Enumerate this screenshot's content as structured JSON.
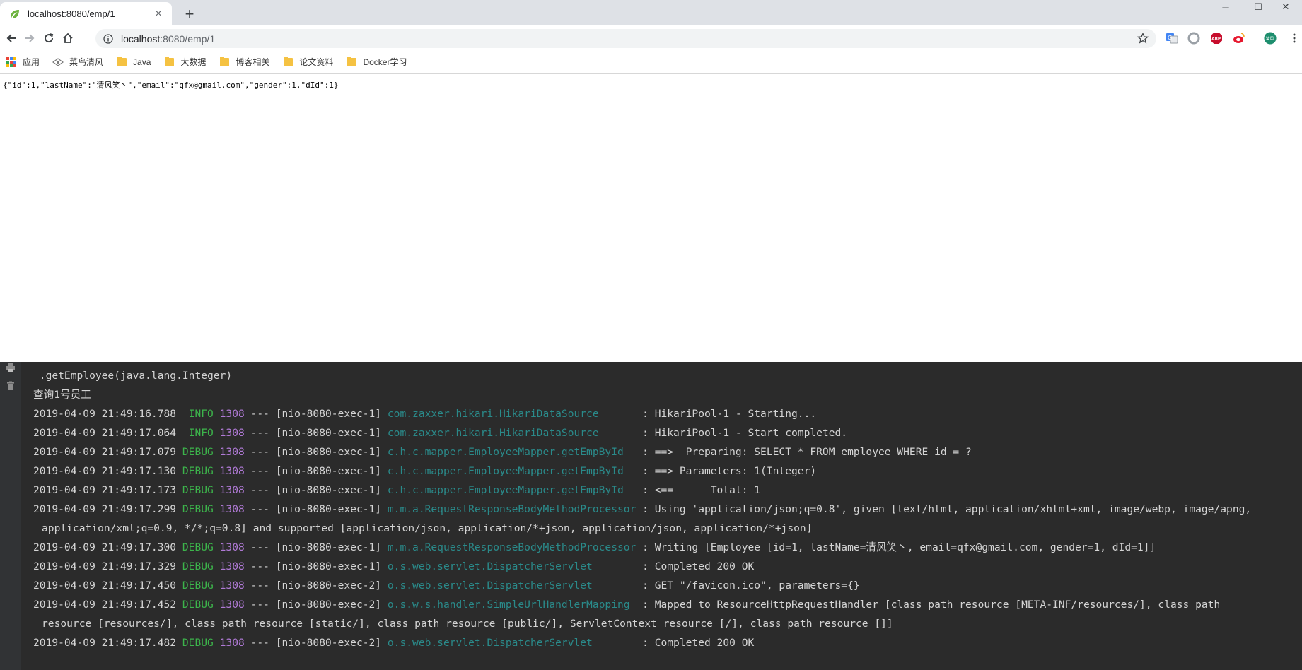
{
  "browser": {
    "tab": {
      "title": "localhost:8080/emp/1",
      "close_glyph": "×"
    },
    "new_tab_glyph": "+",
    "window_controls": {
      "minimize": "─",
      "maximize": "☐",
      "close": "✕"
    },
    "address": {
      "host": "localhost",
      "rest": ":8080/emp/1"
    },
    "bookmarks": [
      {
        "label": "应用",
        "icon": "apps-grid-icon"
      },
      {
        "label": "菜鸟清风",
        "icon": "site-icon"
      },
      {
        "label": "Java",
        "icon": "folder-icon"
      },
      {
        "label": "大数据",
        "icon": "folder-icon"
      },
      {
        "label": "博客相关",
        "icon": "folder-icon"
      },
      {
        "label": "论文资料",
        "icon": "folder-icon"
      },
      {
        "label": "Docker学习",
        "icon": "folder-icon"
      }
    ],
    "extensions": [
      "translate-icon",
      "circle-extension-icon",
      "abp-icon",
      "weibo-icon",
      "profile-avatar-icon",
      "menu-icon"
    ],
    "ext_labels": {
      "abp": "ABP",
      "avatar": "清风"
    }
  },
  "page": {
    "json_text": "{\"id\":1,\"lastName\":\"清风笑丶\",\"email\":\"qfx@gmail.com\",\"gender\":1,\"dId\":1}"
  },
  "console": {
    "lines": [
      {
        "kind": "plain",
        "text": " .getEmployee(java.lang.Integer)"
      },
      {
        "kind": "plain",
        "text": "查询1号员工"
      },
      {
        "kind": "log",
        "ts": "2019-04-09 21:49:16.788",
        "level": " INFO",
        "pid": "1308",
        "sep": " --- ",
        "thread": "[nio-8080-exec-1]",
        "logger": "com.zaxxer.hikari.HikariDataSource       ",
        "msg": ": HikariPool-1 - Starting..."
      },
      {
        "kind": "log",
        "ts": "2019-04-09 21:49:17.064",
        "level": " INFO",
        "pid": "1308",
        "sep": " --- ",
        "thread": "[nio-8080-exec-1]",
        "logger": "com.zaxxer.hikari.HikariDataSource       ",
        "msg": ": HikariPool-1 - Start completed."
      },
      {
        "kind": "log",
        "ts": "2019-04-09 21:49:17.079",
        "level": "DEBUG",
        "pid": "1308",
        "sep": " --- ",
        "thread": "[nio-8080-exec-1]",
        "logger": "c.h.c.mapper.EmployeeMapper.getEmpById   ",
        "msg": ": ==>  Preparing: SELECT * FROM employee WHERE id = ?"
      },
      {
        "kind": "log",
        "ts": "2019-04-09 21:49:17.130",
        "level": "DEBUG",
        "pid": "1308",
        "sep": " --- ",
        "thread": "[nio-8080-exec-1]",
        "logger": "c.h.c.mapper.EmployeeMapper.getEmpById   ",
        "msg": ": ==> Parameters: 1(Integer)"
      },
      {
        "kind": "log",
        "ts": "2019-04-09 21:49:17.173",
        "level": "DEBUG",
        "pid": "1308",
        "sep": " --- ",
        "thread": "[nio-8080-exec-1]",
        "logger": "c.h.c.mapper.EmployeeMapper.getEmpById   ",
        "msg": ": <==      Total: 1"
      },
      {
        "kind": "log",
        "ts": "2019-04-09 21:49:17.299",
        "level": "DEBUG",
        "pid": "1308",
        "sep": " --- ",
        "thread": "[nio-8080-exec-1]",
        "logger": "m.m.a.RequestResponseBodyMethodProcessor",
        "msg": " : Using 'application/json;q=0.8', given [text/html, application/xhtml+xml, image/webp, image/apng,"
      },
      {
        "kind": "cont",
        "text": "application/xml;q=0.9, */*;q=0.8] and supported [application/json, application/*+json, application/json, application/*+json]"
      },
      {
        "kind": "log",
        "ts": "2019-04-09 21:49:17.300",
        "level": "DEBUG",
        "pid": "1308",
        "sep": " --- ",
        "thread": "[nio-8080-exec-1]",
        "logger": "m.m.a.RequestResponseBodyMethodProcessor",
        "msg": " : Writing [Employee [id=1, lastName=清风笑丶, email=qfx@gmail.com, gender=1, dId=1]]"
      },
      {
        "kind": "log",
        "ts": "2019-04-09 21:49:17.329",
        "level": "DEBUG",
        "pid": "1308",
        "sep": " --- ",
        "thread": "[nio-8080-exec-1]",
        "logger": "o.s.web.servlet.DispatcherServlet        ",
        "msg": ": Completed 200 OK"
      },
      {
        "kind": "log",
        "ts": "2019-04-09 21:49:17.450",
        "level": "DEBUG",
        "pid": "1308",
        "sep": " --- ",
        "thread": "[nio-8080-exec-2]",
        "logger": "o.s.web.servlet.DispatcherServlet        ",
        "msg": ": GET \"/favicon.ico\", parameters={}"
      },
      {
        "kind": "log",
        "ts": "2019-04-09 21:49:17.452",
        "level": "DEBUG",
        "pid": "1308",
        "sep": " --- ",
        "thread": "[nio-8080-exec-2]",
        "logger": "o.s.w.s.handler.SimpleUrlHandlerMapping  ",
        "msg": ": Mapped to ResourceHttpRequestHandler [class path resource [META-INF/resources/], class path"
      },
      {
        "kind": "cont",
        "text": "resource [resources/], class path resource [static/], class path resource [public/], ServletContext resource [/], class path resource []]"
      },
      {
        "kind": "log",
        "ts": "2019-04-09 21:49:17.482",
        "level": "DEBUG",
        "pid": "1308",
        "sep": " --- ",
        "thread": "[nio-8080-exec-2]",
        "logger": "o.s.web.servlet.DispatcherServlet        ",
        "msg": ": Completed 200 OK"
      }
    ]
  }
}
